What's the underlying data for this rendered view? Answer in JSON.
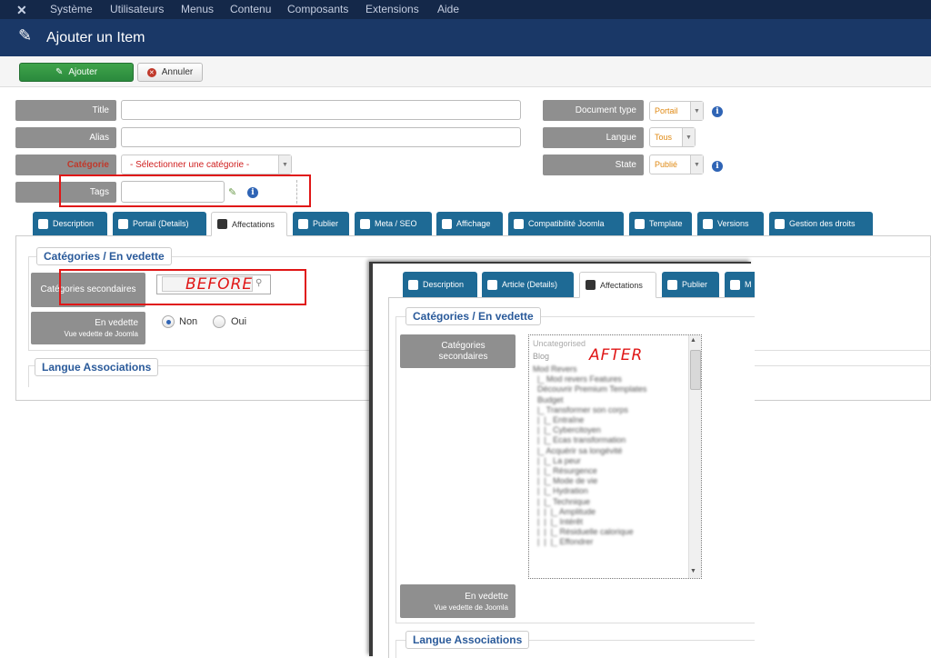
{
  "topnav": {
    "logo": "✕",
    "items": [
      "Système",
      "Utilisateurs",
      "Menus",
      "Contenu",
      "Composants",
      "Extensions",
      "Aide"
    ]
  },
  "header": {
    "title": "Ajouter un Item"
  },
  "toolbar": {
    "save_label": "Ajouter",
    "cancel_label": "Annuler"
  },
  "form": {
    "title_label": "Title",
    "alias_label": "Alias",
    "category_label": "Catégorie",
    "category_value": "- Sélectionner une catégorie -",
    "tags_label": "Tags",
    "doctype_label": "Document type",
    "doctype_value": "Portail",
    "language_label": "Langue",
    "language_value": "Tous",
    "state_label": "State",
    "state_value": "Publié"
  },
  "tabs": [
    "Description",
    "Portail (Details)",
    "Affectations",
    "Publier",
    "Meta / SEO",
    "Affichage",
    "Compatibilité Joomla",
    "Template",
    "Versions",
    "Gestion des droits"
  ],
  "before_panel": {
    "legend": "Catégories / En vedette",
    "secondary_label": "Catégories secondaires",
    "annotation": "BEFORE",
    "featured_label": "En vedette",
    "featured_sublabel": "Vue vedette de Joomla",
    "radio_no": "Non",
    "radio_yes": "Oui",
    "lang_legend": "Langue Associations"
  },
  "after_panel": {
    "tabs": [
      "Description",
      "Article (Details)",
      "Affectations",
      "Publier",
      "M"
    ],
    "legend": "Catégories / En vedette",
    "secondary_label": "Catégories secondaires",
    "annotation": "AFTER",
    "list_items": [
      "Uncategorised",
      "Blog"
    ],
    "blurred_list": "Mod Revers\n  |_ Mod revers Features\n  Découvrir Premium Templates\n  Budget\n  |_ Transformer son corps\n  |  |_ Entraîne\n  |  |_ Cybercitoyen\n  |  |_ Ecas transformation\n  |_ Acquérir sa longévité\n  |  |_ La peur\n  |  |_ Résurgence\n  |  |_ Mode de vie\n  |  |_ Hydration\n  |  |_ Technique\n  |  |  |_ Amplitude\n  |  |  |_ Intérêt\n  |  |  |_ Résiduelle calorique\n  |  |  |_ Effondrer",
    "featured_label": "En vedette",
    "featured_sublabel": "Vue vedette de Joomla",
    "lang_legend": "Langue Associations"
  },
  "colors": {
    "nav": "#142849",
    "header": "#1a3867",
    "tab": "#1e6a95",
    "annotation": "#e01616"
  }
}
